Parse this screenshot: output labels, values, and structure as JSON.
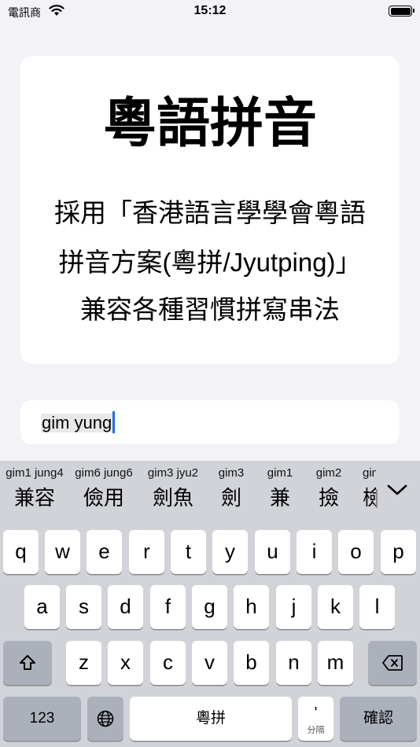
{
  "status": {
    "carrier": "電訊商",
    "time": "15:12"
  },
  "card": {
    "title": "粵語拼音",
    "lines": [
      "採用「香港語言學學會粵語",
      "拼音方案(粵拼/Jyutping)」",
      "兼容各種習慣拼寫串法"
    ]
  },
  "input": {
    "value": "gim yung"
  },
  "candidates": [
    {
      "py": "gim1 jung4",
      "ch": "兼容"
    },
    {
      "py": "gim6 jung6",
      "ch": "儉用"
    },
    {
      "py": "gim3 jyu2",
      "ch": "劍魚"
    },
    {
      "py": "gim3",
      "ch": "劍"
    },
    {
      "py": "gim1",
      "ch": "兼"
    },
    {
      "py": "gim2",
      "ch": "撿"
    },
    {
      "py": "gim",
      "ch": "檢"
    }
  ],
  "keys": {
    "row1": [
      "q",
      "w",
      "e",
      "r",
      "t",
      "y",
      "u",
      "i",
      "o",
      "p"
    ],
    "row2": [
      "a",
      "s",
      "d",
      "f",
      "g",
      "h",
      "j",
      "k",
      "l"
    ],
    "row3": [
      "z",
      "x",
      "c",
      "v",
      "b",
      "n",
      "m"
    ],
    "numbers": "123",
    "space": "粵拼",
    "apostrophe": "'",
    "apostrophe_sub": "分隔",
    "confirm": "確認"
  },
  "icons": {
    "shift": "shift-icon",
    "backspace": "backspace-icon",
    "globe": "globe-icon",
    "wifi": "wifi-icon",
    "battery": "battery-icon",
    "collapse": "chevron-down-icon"
  }
}
